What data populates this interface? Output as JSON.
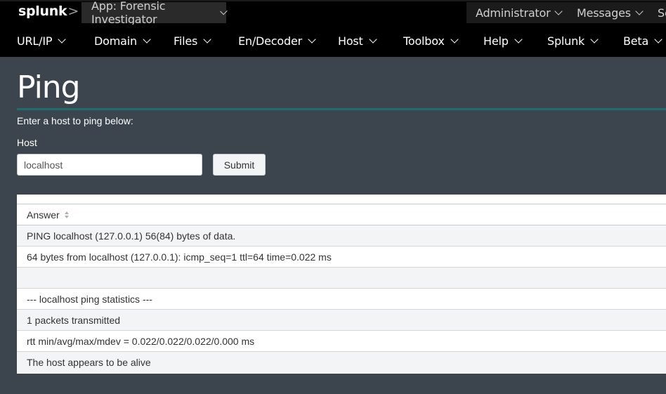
{
  "topbar": {
    "logo_text": "splunk",
    "logo_chevron": ">",
    "app_label": "App: Forensic Investigator",
    "user_label": "Administrator",
    "messages_label": "Messages",
    "settings_label_partial": "Se"
  },
  "nav": {
    "items": [
      {
        "label": "URL/IP"
      },
      {
        "label": "Domain"
      },
      {
        "label": "Files"
      },
      {
        "label": "En/Decoder"
      },
      {
        "label": "Host"
      },
      {
        "label": "Toolbox"
      },
      {
        "label": "Help"
      },
      {
        "label": "Splunk"
      },
      {
        "label": "Beta"
      }
    ]
  },
  "page": {
    "title": "Ping",
    "intro": "Enter a host to ping below:",
    "host_label": "Host",
    "host_value": "localhost",
    "submit_label": "Submit"
  },
  "results": {
    "column_header": "Answer",
    "rows": [
      "PING localhost (127.0.0.1) 56(84) bytes of data.",
      "64 bytes from localhost (127.0.0.1): icmp_seq=1 ttl=64 time=0.022 ms",
      "",
      "--- localhost ping statistics ---",
      "1 packets transmitted",
      "rtt min/avg/max/mdev = 0.022/0.022/0.022/0.000 ms",
      "The host appears to be alive"
    ]
  },
  "colors": {
    "page_bg": "#3c444d",
    "bar_bg": "#000000",
    "accent_rule": "#1e6e6e"
  },
  "icons": [
    "chevron-down-icon",
    "sort-icon"
  ]
}
